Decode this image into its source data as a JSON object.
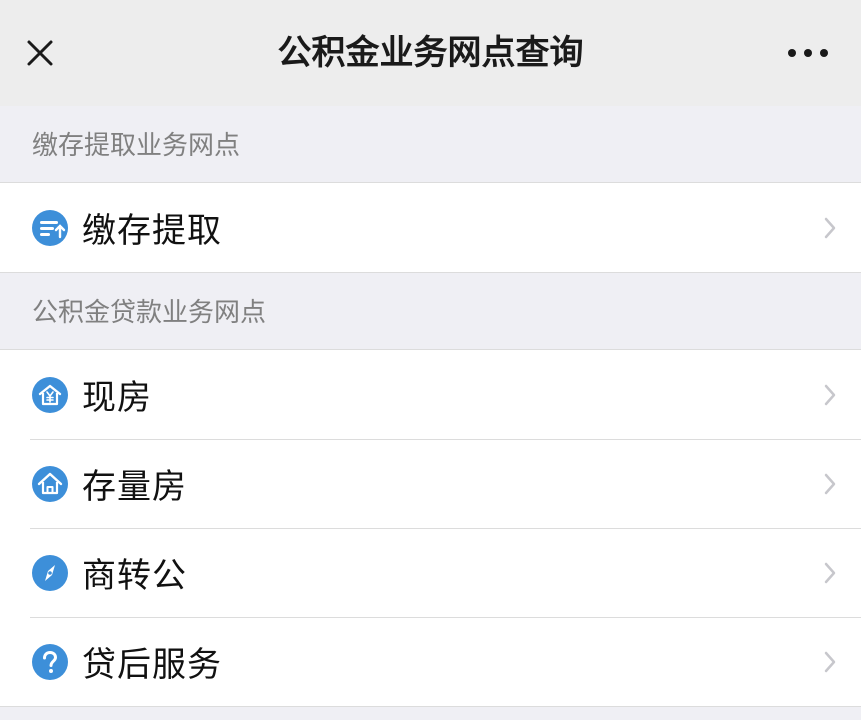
{
  "header": {
    "title": "公积金业务网点查询",
    "close_icon": "close-icon",
    "more_icon": "more-icon"
  },
  "sections": [
    {
      "title": "缴存提取业务网点",
      "items": [
        {
          "label": "缴存提取",
          "icon": "card-icon"
        }
      ]
    },
    {
      "title": "公积金贷款业务网点",
      "items": [
        {
          "label": "现房",
          "icon": "house-yen-icon"
        },
        {
          "label": "存量房",
          "icon": "house-icon"
        },
        {
          "label": "商转公",
          "icon": "compass-icon"
        },
        {
          "label": "贷后服务",
          "icon": "question-icon"
        }
      ]
    }
  ],
  "colors": {
    "accent": "#3d8fd9",
    "background": "#efeff4",
    "section_text": "#808080",
    "chevron": "#c7c7cc"
  }
}
